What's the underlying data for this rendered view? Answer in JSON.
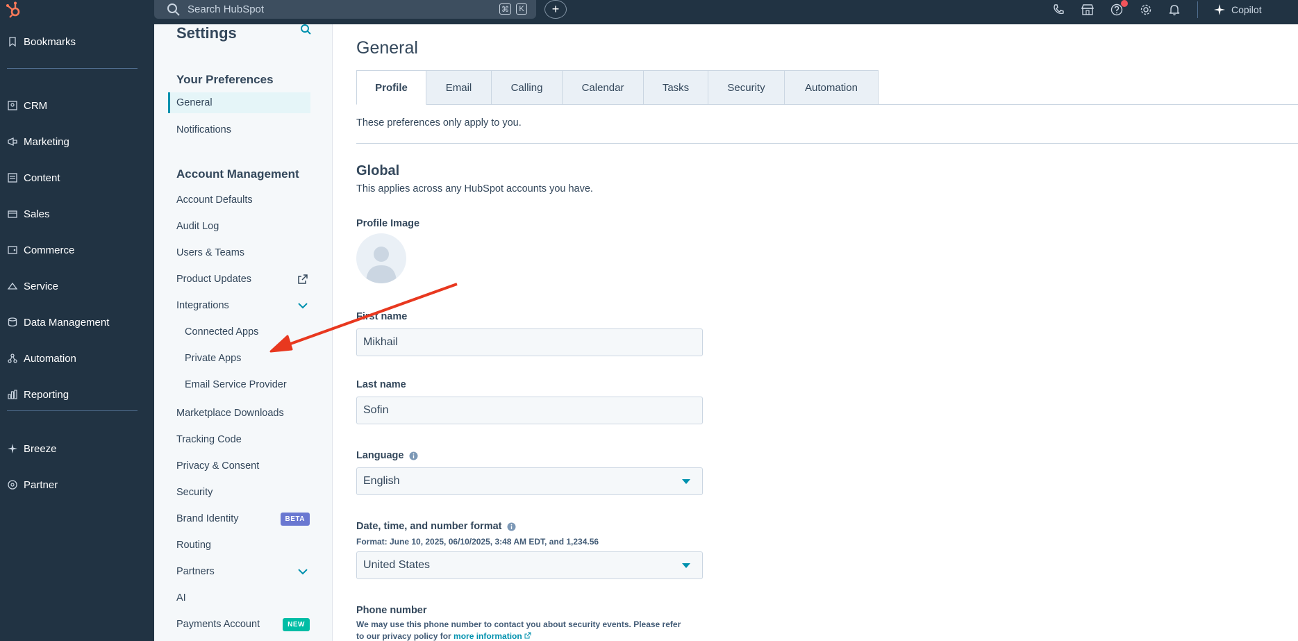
{
  "topbar": {
    "search_placeholder": "Search HubSpot",
    "shortcut_cmd": "⌘",
    "shortcut_key": "K",
    "add_label": "+",
    "copilot_label": "Copilot"
  },
  "leftnav": {
    "items": [
      {
        "label": "Bookmarks",
        "icon": "bookmark-icon"
      },
      {
        "label": "CRM",
        "icon": "contacts-icon"
      },
      {
        "label": "Marketing",
        "icon": "megaphone-icon"
      },
      {
        "label": "Content",
        "icon": "content-icon"
      },
      {
        "label": "Sales",
        "icon": "sales-icon"
      },
      {
        "label": "Commerce",
        "icon": "commerce-icon"
      },
      {
        "label": "Service",
        "icon": "service-icon"
      },
      {
        "label": "Data Management",
        "icon": "database-icon"
      },
      {
        "label": "Automation",
        "icon": "automation-icon"
      },
      {
        "label": "Reporting",
        "icon": "reporting-icon"
      },
      {
        "label": "Breeze",
        "icon": "breeze-icon"
      },
      {
        "label": "Partner",
        "icon": "partner-icon"
      }
    ]
  },
  "settings": {
    "title": "Settings",
    "your_preferences": "Your Preferences",
    "general": "General",
    "notifications": "Notifications",
    "account_management": "Account Management",
    "items": {
      "account_defaults": "Account Defaults",
      "audit_log": "Audit Log",
      "users_teams": "Users & Teams",
      "product_updates": "Product Updates",
      "integrations": "Integrations",
      "connected_apps": "Connected Apps",
      "private_apps": "Private Apps",
      "email_service_provider": "Email Service Provider",
      "marketplace_downloads": "Marketplace Downloads",
      "tracking_code": "Tracking Code",
      "privacy_consent": "Privacy & Consent",
      "security": "Security",
      "brand_identity": "Brand Identity",
      "routing": "Routing",
      "partners": "Partners",
      "ai": "AI",
      "payments_account": "Payments Account"
    },
    "beta_tag": "BETA",
    "new_tag": "NEW"
  },
  "main": {
    "title": "General",
    "tabs": [
      "Profile",
      "Email",
      "Calling",
      "Calendar",
      "Tasks",
      "Security",
      "Automation"
    ],
    "active_tab": "Profile",
    "prefs_note": "These preferences only apply to you.",
    "global_heading": "Global",
    "global_sub": "This applies across any HubSpot accounts you have.",
    "profile_image_label": "Profile Image",
    "first_name_label": "First name",
    "first_name_value": "Mikhail",
    "last_name_label": "Last name",
    "last_name_value": "Sofin",
    "language_label": "Language",
    "language_value": "English",
    "date_format_label": "Date, time, and number format",
    "date_format_hint": "Format: June 10, 2025, 06/10/2025, 3:48 AM EDT, and 1,234.56",
    "date_format_value": "United States",
    "phone_label": "Phone number",
    "phone_hint": "We may use this phone number to contact you about security events. Please refer",
    "phone_hint2": "to our privacy policy for",
    "more_info_link": "more information"
  },
  "colors": {
    "nav_bg": "#213343",
    "accent": "#0091ae",
    "annotation_arrow": "#e8381f"
  }
}
